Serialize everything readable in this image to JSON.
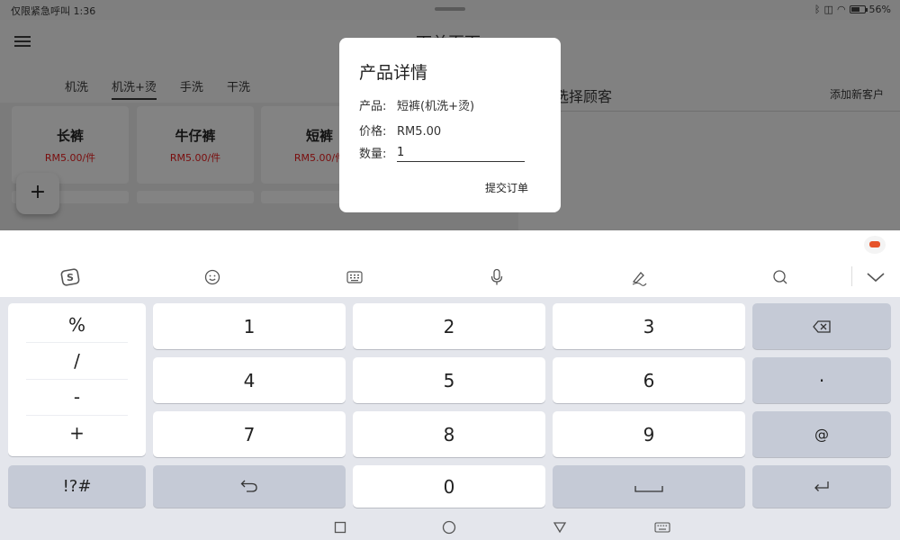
{
  "status_bar": {
    "left_text": "仅限紧急呼叫 1:36",
    "battery": "56%"
  },
  "app": {
    "title": "下单页面",
    "tabs": [
      "机洗",
      "机洗+烫",
      "手洗",
      "干洗"
    ],
    "active_tab": "机洗+烫",
    "products": [
      {
        "name": "长裤",
        "price": "RM5.00/件"
      },
      {
        "name": "牛仔裤",
        "price": "RM5.00/件"
      },
      {
        "name": "短裤",
        "price": "RM5.00/件"
      }
    ],
    "fab": "+",
    "customer_placeholder": "选择顾客",
    "add_customer": "添加新客户"
  },
  "dialog": {
    "title": "产品详情",
    "product_label": "产品:",
    "product_value": "短裤(机洗+烫)",
    "price_label": "价格:",
    "price_value": "RM5.00",
    "quantity_label": "数量:",
    "quantity_value": "1",
    "submit_label": "提交订单"
  },
  "keyboard": {
    "toolbar_icons": [
      "sogou-logo-icon",
      "emoji-icon",
      "keyboard-layout-icon",
      "microphone-icon",
      "handwriting-icon",
      "search-icon",
      "collapse-keyboard-icon"
    ],
    "symbols": [
      "%",
      "/",
      "-",
      "+"
    ],
    "digits": [
      "1",
      "2",
      "3",
      "4",
      "5",
      "6",
      "7",
      "8",
      "9",
      "0"
    ],
    "dot": "·",
    "at": "@",
    "symbols_switch": "!?#"
  }
}
